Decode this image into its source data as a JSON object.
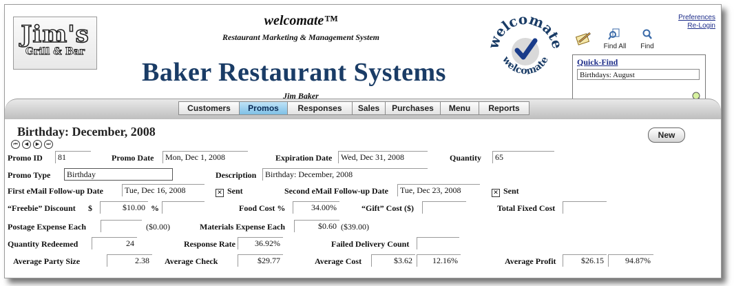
{
  "header": {
    "logo_line1": "Jim's",
    "logo_line2": "Grill & Bar",
    "product_title": "welcomate™",
    "product_subtitle": "Restaurant Marketing & Management System",
    "company_name": "Baker Restaurant Systems",
    "user_name": "Jim Baker",
    "seal_text": "welcomate",
    "links": {
      "preferences": "Preferences",
      "relogin": "Re-Login"
    },
    "tools": {
      "find_all": "Find All",
      "find": "Find"
    },
    "quick_find": {
      "title": "Quick-Find",
      "value": "Birthdays:  August"
    }
  },
  "tabs": [
    {
      "label": "Customers",
      "active": false
    },
    {
      "label": "Promos",
      "active": true
    },
    {
      "label": "Responses",
      "active": false
    },
    {
      "label": "Sales",
      "active": false
    },
    {
      "label": "Purchases",
      "active": false
    },
    {
      "label": "Menu",
      "active": false
    },
    {
      "label": "Reports",
      "active": false
    }
  ],
  "record": {
    "title": "Birthday: December, 2008",
    "new_button": "New",
    "nav_icons": [
      "first-record-icon",
      "prev-record-icon",
      "next-record-icon",
      "last-record-icon"
    ],
    "labels": {
      "promo_id": "Promo ID",
      "promo_date": "Promo Date",
      "expiration_date": "Expiration Date",
      "quantity": "Quantity",
      "promo_type": "Promo Type",
      "description": "Description",
      "first_followup": "First eMail Follow-up Date",
      "sent1": "Sent",
      "second_followup": "Second eMail Follow-up Date",
      "sent2": "Sent",
      "freebie_discount": "“Freebie” Discount",
      "dollar": "$",
      "percent": "%",
      "food_cost": "Food Cost %",
      "gift_cost": "“Gift” Cost ($)",
      "total_fixed_cost": "Total Fixed Cost",
      "postage_each": "Postage Expense Each",
      "materials_each": "Materials Expense Each",
      "quantity_redeemed": "Quantity Redeemed",
      "response_rate": "Response Rate",
      "failed_delivery": "Failed Delivery Count",
      "avg_party_size": "Average Party Size",
      "avg_check": "Average Check",
      "avg_cost": "Average Cost",
      "avg_profit": "Average Profit"
    },
    "values": {
      "promo_id": "81",
      "promo_date": "Mon, Dec 1, 2008",
      "expiration_date": "Wed, Dec 31, 2008",
      "quantity": "65",
      "promo_type": "Birthday",
      "description": "Birthday: December, 2008",
      "first_followup": "Tue, Dec 16, 2008",
      "second_followup": "Tue, Dec 23, 2008",
      "freebie_discount": "$10.00",
      "freebie_percent": "",
      "food_cost": "34.00%",
      "gift_cost": "",
      "total_fixed_cost": "",
      "postage_each": "",
      "postage_total": "($0.00)",
      "materials_each": "$0.60",
      "materials_total": "($39.00)",
      "quantity_redeemed": "24",
      "response_rate": "36.92%",
      "failed_delivery": "",
      "avg_party_size": "2.38",
      "avg_check": "$29.77",
      "avg_cost": "$3.62",
      "avg_cost_pct": "12.16%",
      "avg_profit": "$26.15",
      "avg_profit_pct": "94.87%"
    },
    "sent1_checked": true,
    "sent2_checked": true
  }
}
